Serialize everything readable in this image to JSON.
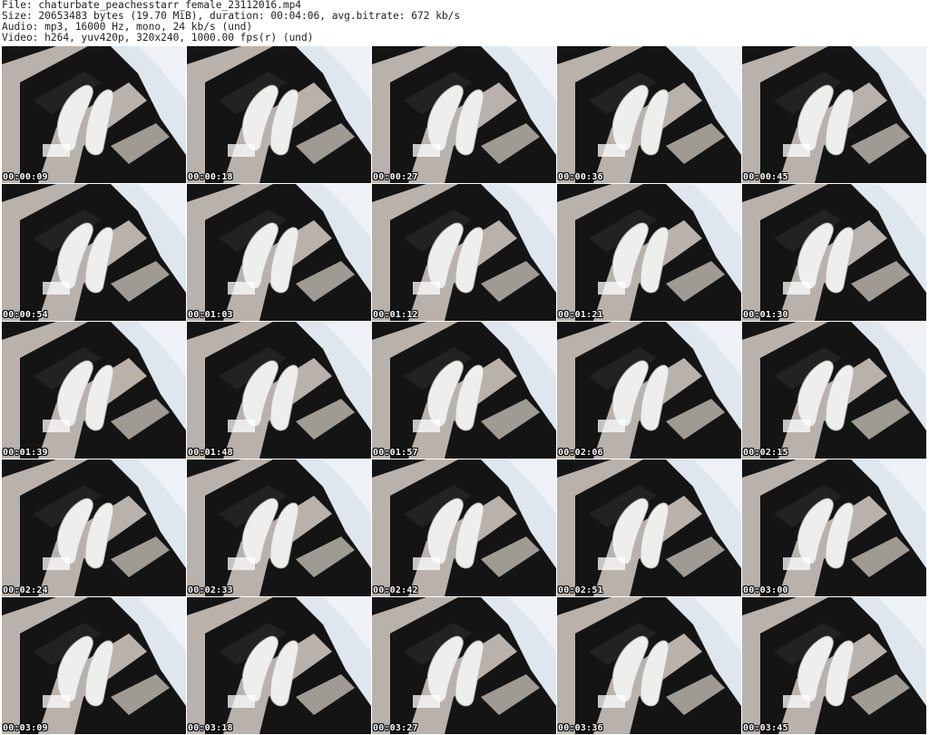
{
  "header": {
    "file_line": "File: chaturbate_peachesstarr_female_23112016.mp4",
    "size_line": "Size: 20653483 bytes (19.70 MiB), duration: 00:04:06, avg.bitrate: 672 kb/s",
    "audio_line": "Audio: mp3, 16000 Hz, mono, 24 kb/s (und)",
    "video_line": "Video: h264, yuv420p, 320x240, 1000.00 fps(r) (und)"
  },
  "thumbnails": [
    {
      "time": "00:00:09"
    },
    {
      "time": "00:00:18"
    },
    {
      "time": "00:00:27"
    },
    {
      "time": "00:00:36"
    },
    {
      "time": "00:00:45"
    },
    {
      "time": "00:00:54"
    },
    {
      "time": "00:01:03"
    },
    {
      "time": "00:01:12"
    },
    {
      "time": "00:01:21"
    },
    {
      "time": "00:01:30"
    },
    {
      "time": "00:01:39"
    },
    {
      "time": "00:01:48"
    },
    {
      "time": "00:01:57"
    },
    {
      "time": "00:02:06"
    },
    {
      "time": "00:02:15"
    },
    {
      "time": "00:02:24"
    },
    {
      "time": "00:02:33"
    },
    {
      "time": "00:02:42"
    },
    {
      "time": "00:02:51"
    },
    {
      "time": "00:03:00"
    },
    {
      "time": "00:03:09"
    },
    {
      "time": "00:03:18"
    },
    {
      "time": "00:03:27"
    },
    {
      "time": "00:03:36"
    },
    {
      "time": "00:03:45"
    }
  ],
  "colors": {
    "rug_dark": "#141414",
    "rug_light": "#b9b1ab",
    "sheet": "#dfe6ee",
    "shoe": "#eeeeec"
  }
}
